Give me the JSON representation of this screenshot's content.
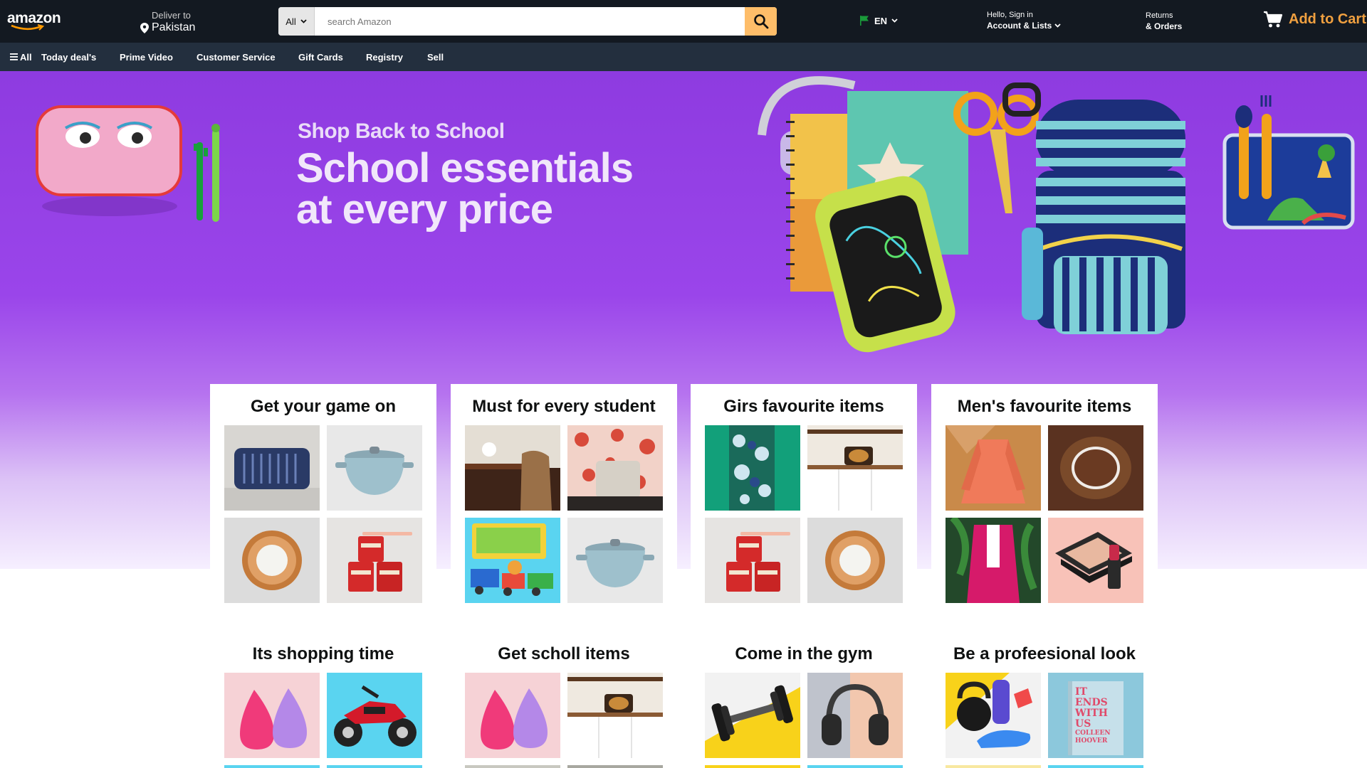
{
  "header": {
    "logo_text": "amazon",
    "deliver_label": "Deliver to",
    "deliver_location": "Pakistan",
    "search": {
      "category": "All",
      "placeholder": "search Amazon"
    },
    "language": "EN",
    "account_greeting": "Hello, Sign in",
    "account_label": "Account & Lists",
    "returns_label": "Returns",
    "orders_label": "& Orders",
    "cart_label": "Add to Cart"
  },
  "nav": {
    "all_label": "All",
    "items": [
      "Today deal's",
      "Prime Video",
      "Customer Service",
      "Gift Cards",
      "Registry",
      "Sell"
    ]
  },
  "hero": {
    "kicker": "Shop Back to School",
    "title_line1": "School essentials",
    "title_line2": "at every price"
  },
  "cards": [
    {
      "title": "Get your game on",
      "tiles": [
        "blue-pillow",
        "dutch-oven",
        "round-mirror",
        "red-canisters"
      ]
    },
    {
      "title": "Must for every student",
      "tiles": [
        "wooden-desk",
        "floral-wall-chair",
        "lego-duplo-train",
        "dutch-oven"
      ]
    },
    {
      "title": "Girs favourite items",
      "tiles": [
        "floral-fabric",
        "kitchen-shelf",
        "red-canisters",
        "round-mirror"
      ]
    },
    {
      "title": "Men's favourite items",
      "tiles": [
        "coral-jacket",
        "fur-necklace",
        "pink-blazer",
        "makeup-palette"
      ]
    },
    {
      "title": "Its shopping time",
      "tiles": [
        "beauty-sponges",
        "red-atv",
        "",
        ""
      ]
    },
    {
      "title": "Get scholl items",
      "tiles": [
        "beauty-sponges",
        "kitchen-shelf",
        "",
        ""
      ]
    },
    {
      "title": "Come in the gym",
      "tiles": [
        "dumbbell",
        "headphones",
        "",
        ""
      ]
    },
    {
      "title": "Be a profeesional look",
      "tiles": [
        "kettlebell-set",
        "book-it-ends-with-us",
        "",
        ""
      ]
    }
  ],
  "book_text": {
    "line1": "IT ENDS",
    "line2": "WITH",
    "line3": "US",
    "author": "COLLEEN HOOVER"
  }
}
